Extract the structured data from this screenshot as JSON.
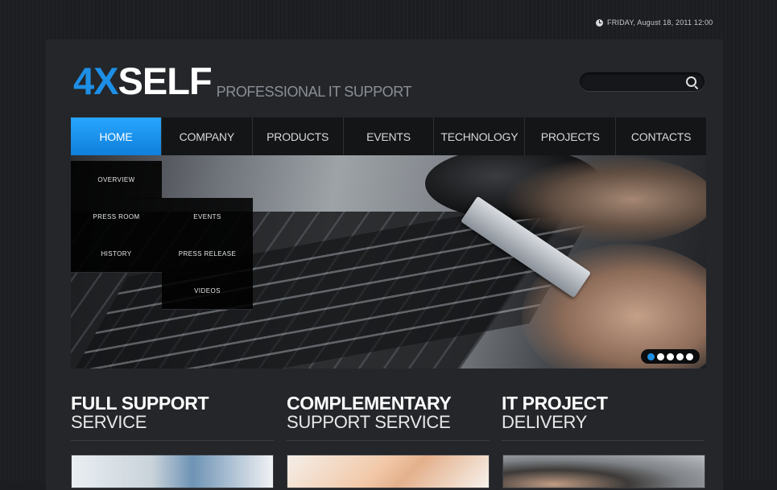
{
  "header": {
    "date_text": "FRIDAY, August 18, 2011 12:00",
    "logo_accent": "4X",
    "logo_main": "SELF",
    "tagline": "PROFESSIONAL IT SUPPORT",
    "search_placeholder": ""
  },
  "nav": {
    "items": [
      {
        "label": "HOME",
        "active": true
      },
      {
        "label": "COMPANY"
      },
      {
        "label": "PRODUCTS"
      },
      {
        "label": "EVENTS"
      },
      {
        "label": "TECHNOLOGY"
      },
      {
        "label": "PROJECTS"
      },
      {
        "label": "CONTACTS"
      }
    ]
  },
  "submenu": {
    "overview": "OVERVIEW",
    "press_room": "PRESS ROOM",
    "history": "HISTORY",
    "events": "EVENTS",
    "press_release": "PRESS RELEASE",
    "videos": "VIDEOS"
  },
  "slider": {
    "total_slides": 5,
    "active_slide": 1
  },
  "columns": [
    {
      "title": "FULL SUPPORT",
      "subtitle": "SERVICE"
    },
    {
      "title": "COMPLEMENTARY",
      "subtitle": "SUPPORT SERVICE"
    },
    {
      "title": "IT PROJECT",
      "subtitle": "DELIVERY"
    }
  ],
  "colors": {
    "accent": "#1d8fe6",
    "background": "#1b1d21",
    "panel": "#24262a"
  }
}
